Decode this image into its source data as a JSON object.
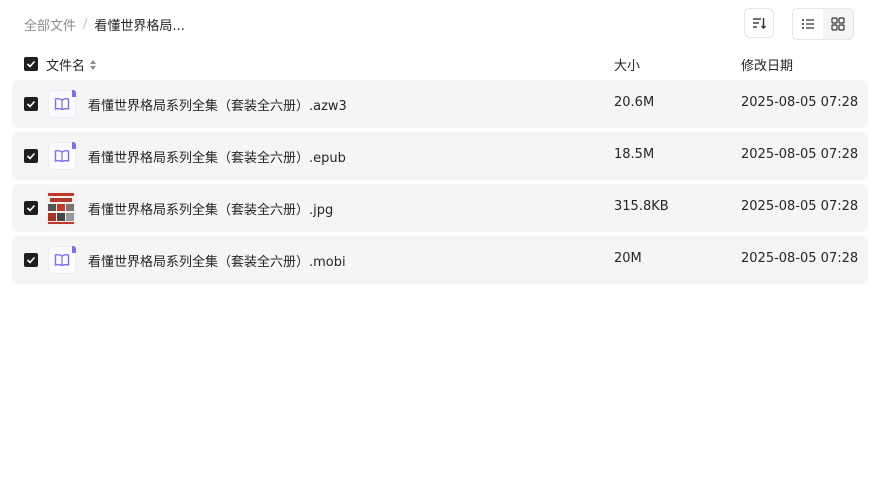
{
  "breadcrumb": {
    "root": "全部文件",
    "separator": "/",
    "current": "看懂世界格局..."
  },
  "columns": {
    "name": "文件名",
    "size": "大小",
    "date": "修改日期"
  },
  "files": [
    {
      "name": "看懂世界格局系列全集（套装全六册）.azw3",
      "size": "20.6M",
      "date": "2025-08-05 07:28",
      "icon": "ebook-icon"
    },
    {
      "name": "看懂世界格局系列全集（套装全六册）.epub",
      "size": "18.5M",
      "date": "2025-08-05 07:28",
      "icon": "ebook-icon"
    },
    {
      "name": "看懂世界格局系列全集（套装全六册）.jpg",
      "size": "315.8KB",
      "date": "2025-08-05 07:28",
      "icon": "image-thumbnail"
    },
    {
      "name": "看懂世界格局系列全集（套装全六册）.mobi",
      "size": "20M",
      "date": "2025-08-05 07:28",
      "icon": "ebook-icon"
    }
  ],
  "colors": {
    "accent": "#7b6cf0",
    "row_bg": "#f5f5f5",
    "checkbox": "#1f1f1f"
  }
}
